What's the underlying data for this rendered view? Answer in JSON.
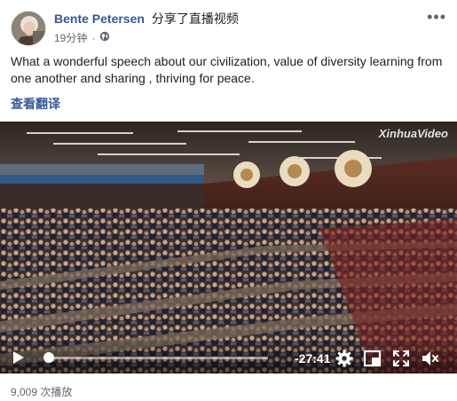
{
  "post": {
    "author": "Bente Petersen",
    "action": "分享了直播视频",
    "time": "19分钟",
    "separator": "·",
    "privacy_icon": "globe-icon",
    "more_icon": "more-options-icon",
    "more_glyph": "•••",
    "text": "What a wonderful speech about our civilization, value of diversity learning from one another and sharing , thriving for peace.",
    "translate_label": "查看翻译"
  },
  "video": {
    "watermark": "XinhuaVideo",
    "time_remaining": "-27:41",
    "progress": 0.01,
    "icons": [
      "play-icon",
      "settings-icon",
      "picture-in-picture-icon",
      "fullscreen-icon",
      "volume-icon"
    ]
  },
  "footer": {
    "views": "9,009 次播放"
  },
  "colors": {
    "link": "#385898",
    "meta": "#606770",
    "text": "#1c1e21"
  }
}
